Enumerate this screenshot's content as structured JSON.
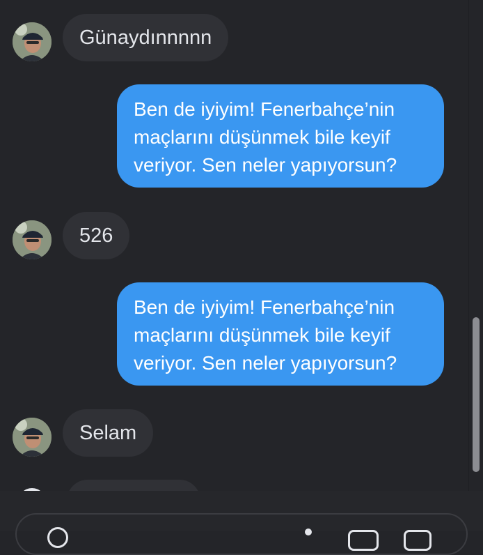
{
  "messages": [
    {
      "direction": "incoming",
      "text": "Günaydınnnnn"
    },
    {
      "direction": "outgoing",
      "lines": [
        "Ben de iyiyim! Fenerbahçe’nin",
        "maçlarını düşünmek bile keyif",
        "veriyor. Sen neler yapıyorsun?"
      ]
    },
    {
      "direction": "incoming",
      "text": "526"
    },
    {
      "direction": "outgoing",
      "lines": [
        "Ben de iyiyim! Fenerbahçe’nin",
        "maçlarını düşünmek bile keyif",
        "veriyor. Sen neler yapıyorsun?"
      ]
    },
    {
      "direction": "incoming",
      "text": "Selam"
    }
  ],
  "colors": {
    "background": "#242529",
    "incoming_bubble": "#303136",
    "outgoing_bubble": "#3a97f1",
    "text": "#e4e6eb"
  }
}
